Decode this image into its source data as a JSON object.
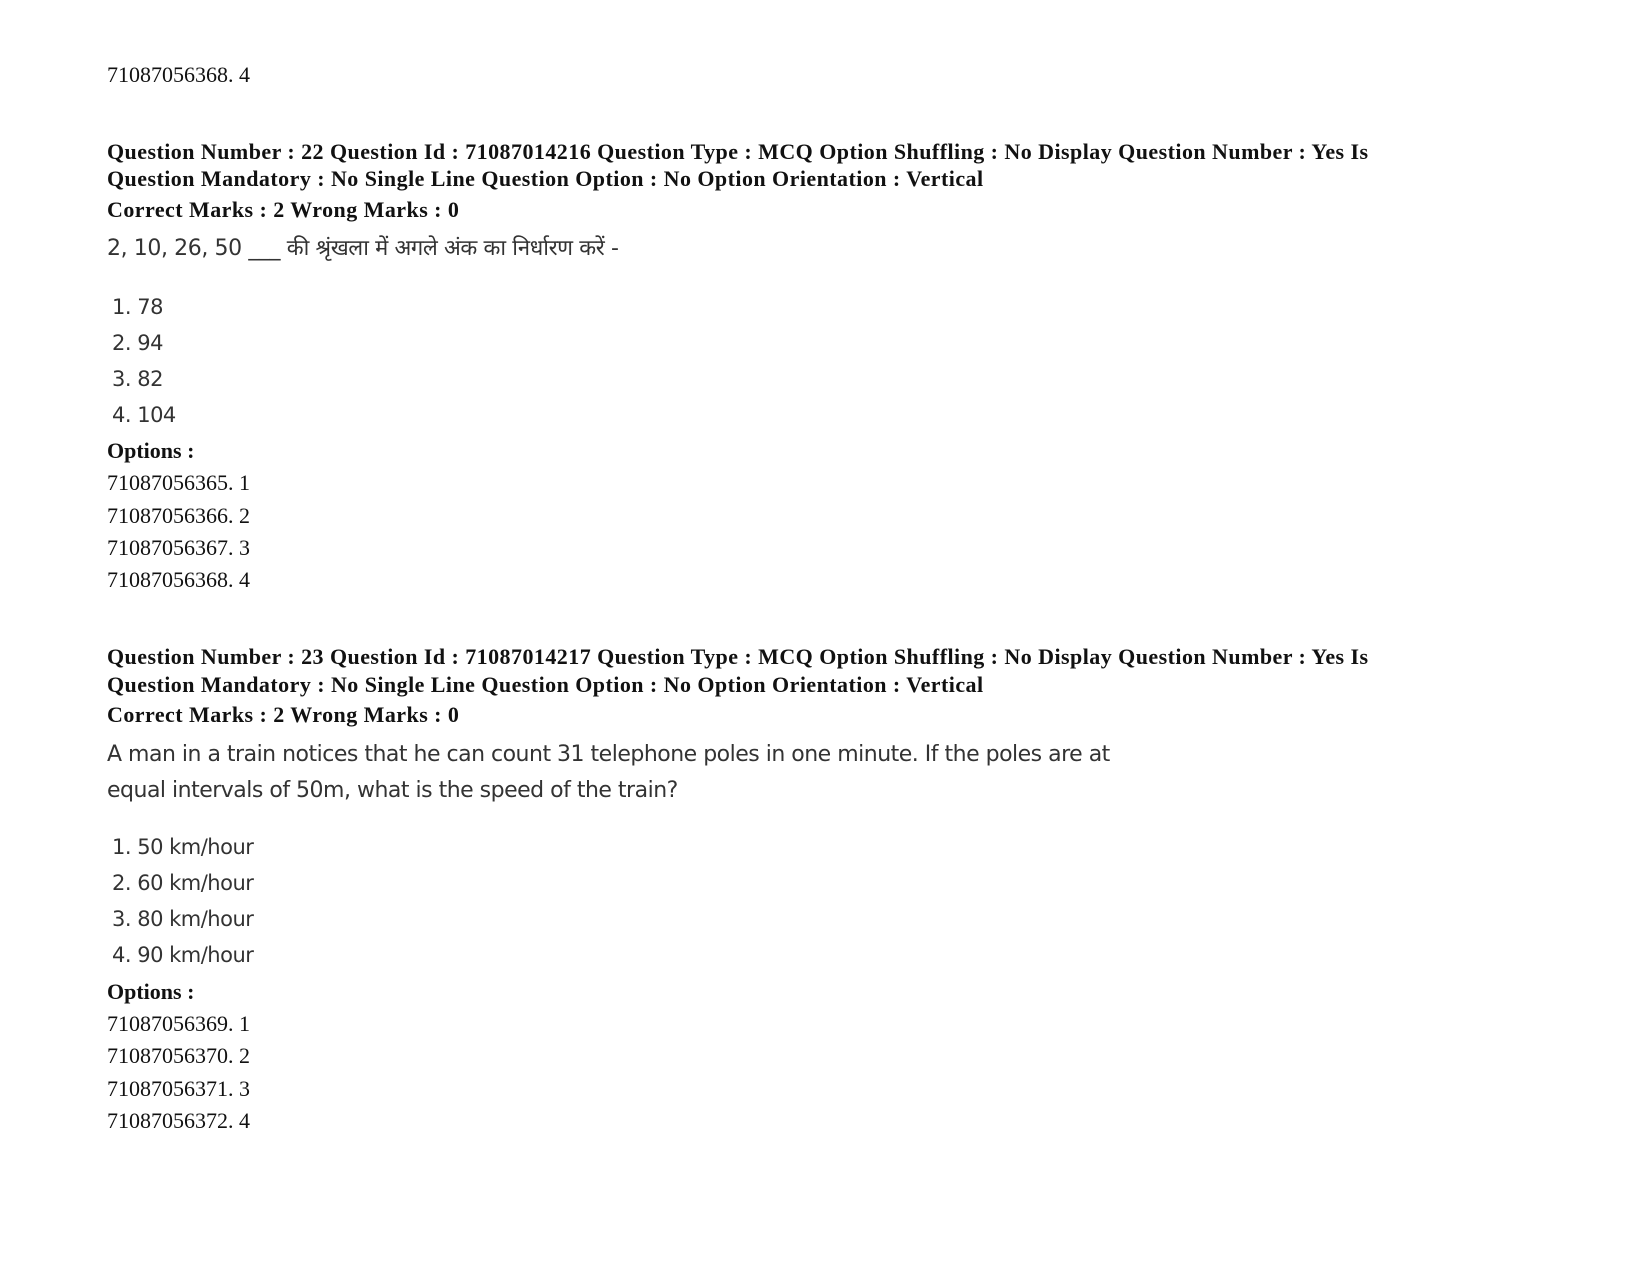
{
  "top_fragment": "71087056368. 4",
  "questions": [
    {
      "meta_line1": "Question Number : 22 Question Id : 71087014216 Question Type : MCQ Option Shuffling : No Display Question Number : Yes Is",
      "meta_line2": "Question Mandatory : No Single Line Question Option : No Option Orientation : Vertical",
      "marks": "Correct Marks : 2 Wrong Marks : 0",
      "question_text": "2, 10, 26, 50 ___ की श्रृंखला में अगले अंक का निर्धारण करें -",
      "choices": [
        "1. 78",
        "2. 94",
        "3. 82",
        "4. 104"
      ],
      "options_label": "Options :",
      "option_ids": [
        "71087056365. 1",
        "71087056366. 2",
        "71087056367. 3",
        "71087056368. 4"
      ]
    },
    {
      "meta_line1": "Question Number : 23 Question Id : 71087014217 Question Type : MCQ Option Shuffling : No Display Question Number : Yes Is",
      "meta_line2": "Question Mandatory : No Single Line Question Option : No Option Orientation : Vertical",
      "marks": "Correct Marks : 2 Wrong Marks : 0",
      "question_text_line1": "A man in a train notices that he can count 31 telephone poles in one minute. If the poles are at",
      "question_text_line2": "equal intervals of 50m, what is the speed of the train?",
      "choices": [
        "1. 50 km/hour",
        "2. 60 km/hour",
        "3. 80 km/hour",
        "4. 90 km/hour"
      ],
      "options_label": "Options :",
      "option_ids": [
        "71087056369. 1",
        "71087056370. 2",
        "71087056371. 3",
        "71087056372. 4"
      ]
    }
  ]
}
